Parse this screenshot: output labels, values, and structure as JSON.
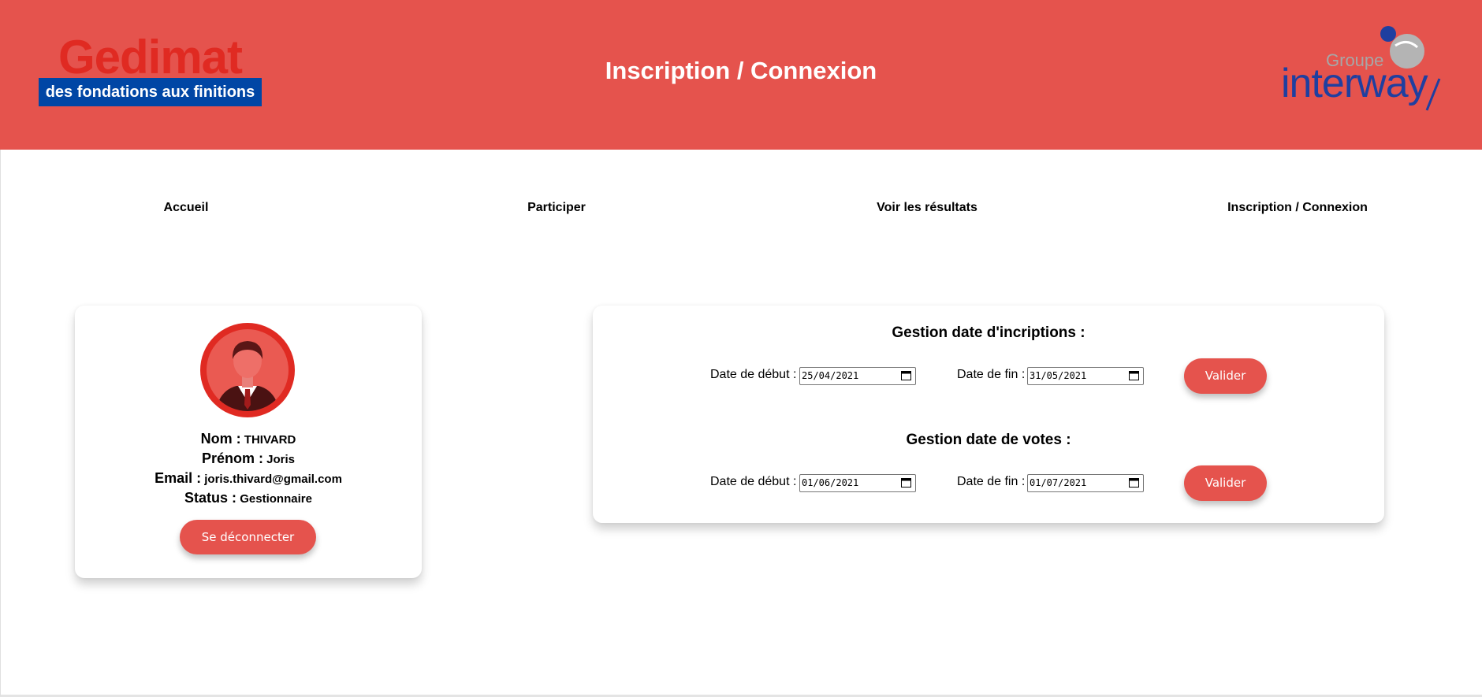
{
  "header": {
    "title": "Inscription / Connexion",
    "gedimat_logo": {
      "name": "Gedimat",
      "tagline": "des fondations aux finitions"
    },
    "interway_logo": {
      "groupe": "Groupe",
      "name": "interway"
    },
    "background_color": "#e5534d"
  },
  "nav": {
    "items": [
      {
        "label": "Accueil"
      },
      {
        "label": "Participer"
      },
      {
        "label": "Voir les résultats"
      },
      {
        "label": "Inscription / Connexion"
      }
    ]
  },
  "profile": {
    "avatar_icon": "user-avatar-icon",
    "nom_label": "Nom :",
    "nom_value": "THIVARD",
    "prenom_label": "Prénom :",
    "prenom_value": "Joris",
    "email_label": "Email :",
    "email_value": "joris.thivard@gmail.com",
    "status_label": "Status :",
    "status_value": "Gestionnaire",
    "logout_label": "Se déconnecter"
  },
  "admin": {
    "inscriptions": {
      "title": "Gestion date d'incriptions :",
      "start_label": "Date de début :",
      "start_value": "25/04/2021",
      "end_label": "Date de fin :",
      "end_value": "31/05/2021",
      "submit_label": "Valider"
    },
    "votes": {
      "title": "Gestion date de votes :",
      "start_label": "Date de début :",
      "start_value": "01/06/2021",
      "end_label": "Date de fin :",
      "end_value": "01/07/2021",
      "submit_label": "Valider"
    }
  },
  "colors": {
    "accent": "#e5534d",
    "brand_red": "#e02a22",
    "brand_blue": "#0046a5",
    "interway_blue": "#1f3fa0"
  }
}
